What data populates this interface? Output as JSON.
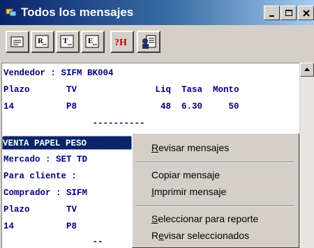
{
  "window": {
    "title": "Todos los mensajes"
  },
  "title_buttons": {
    "minimize": "_",
    "maximize": "□",
    "close": "X"
  },
  "toolbar": {
    "tools": [
      {
        "icon": "message-list-icon",
        "letter": ""
      },
      {
        "icon": "report-r-icon",
        "letter": "R"
      },
      {
        "icon": "report-t-icon",
        "letter": "T"
      },
      {
        "icon": "report-e-icon",
        "letter": "E"
      },
      {
        "icon": "help-icon",
        "letter": "?H"
      },
      {
        "icon": "user-document-icon",
        "letter": ""
      }
    ]
  },
  "content": {
    "lines": [
      "Vendedor : SIFM BK004",
      "Plazo       TV               Liq  Tasa  Monto",
      "14          P8                48  6.30     50",
      "                 ----------",
      "VENTA PAPEL PESO",
      "Mercado : SET TD",
      "Para cliente :",
      "Comprador : SIFM",
      "Plazo       TV",
      "14          P8",
      "                 --"
    ],
    "selected_line_index": 4
  },
  "context_menu": {
    "items": [
      {
        "label": "Revisar mensajes",
        "accel": "R"
      },
      {
        "label": "Copiar mensaje",
        "accel": "C"
      },
      {
        "label": "Imprimir mensaje",
        "accel": "I"
      },
      {
        "label": "Seleccionar para reporte",
        "accel": "S"
      },
      {
        "label": "Revisar seleccionados",
        "accel": "e"
      }
    ]
  },
  "colors": {
    "title_start": "#0a246a",
    "title_end": "#a6caf0",
    "text": "#000080",
    "selection": "#0a246a"
  }
}
